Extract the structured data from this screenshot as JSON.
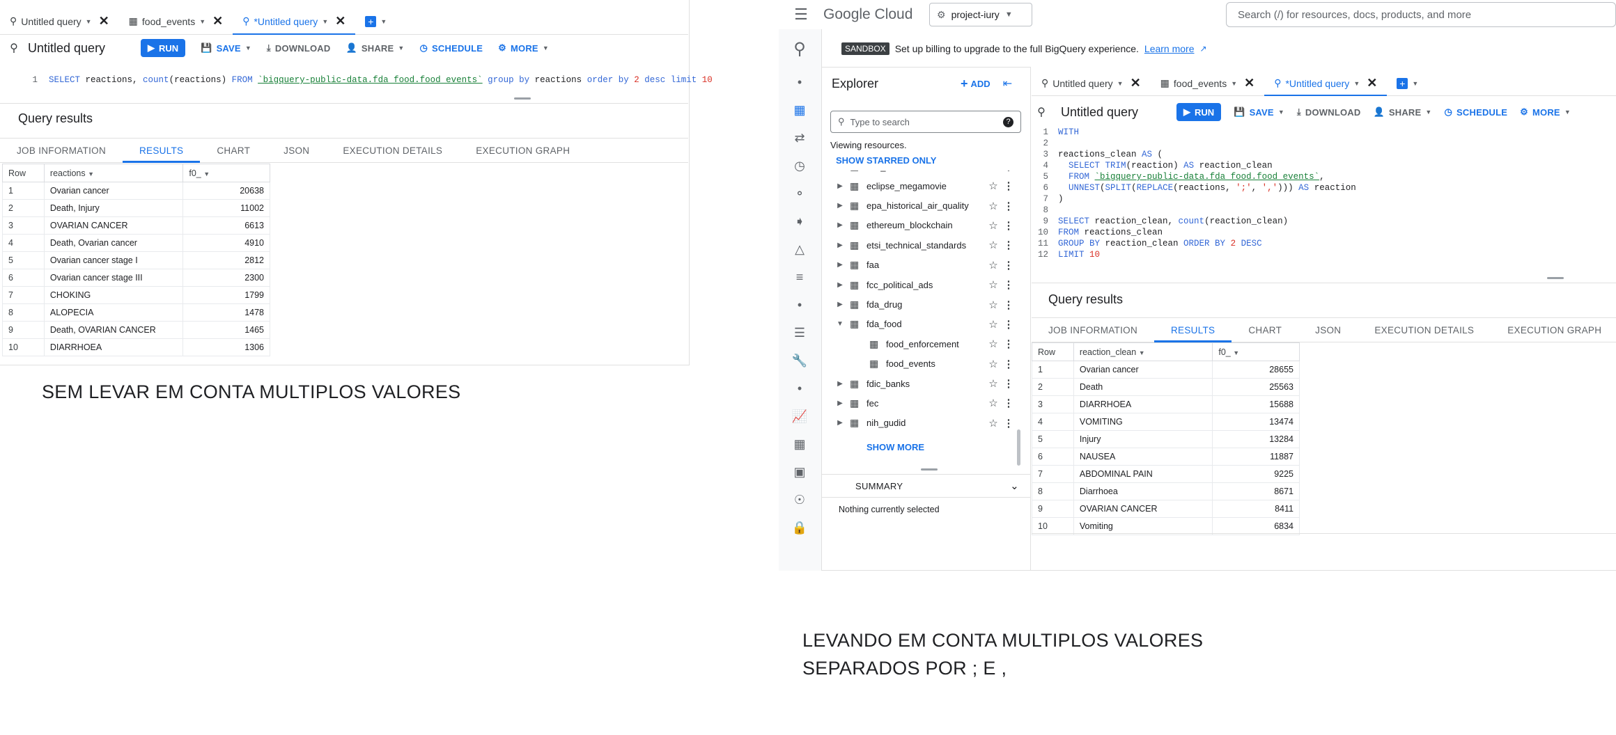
{
  "left": {
    "tabs": [
      {
        "label": "Untitled query",
        "icon": "query-icon",
        "active": false
      },
      {
        "label": "food_events",
        "icon": "table-icon",
        "active": false
      },
      {
        "label": "*Untitled query",
        "icon": "query-icon",
        "active": true
      }
    ],
    "title": "Untitled query",
    "toolbar": {
      "run": "RUN",
      "save": "SAVE",
      "download": "DOWNLOAD",
      "share": "SHARE",
      "schedule": "SCHEDULE",
      "more": "MORE"
    },
    "editor": {
      "line_no": "1",
      "select_kw": "SELECT",
      "select_cols": " reactions, ",
      "count_fn": "count",
      "count_arg": "(reactions) ",
      "from_kw": "FROM ",
      "table": "`bigquery-public-data.fda_food.food_events`",
      "group_kw": " group by",
      "group_col": " reactions",
      "order_kw": " order by ",
      "order_num": "2",
      "desc_kw": " desc limit ",
      "limit_num": "10"
    },
    "results_title": "Query results",
    "result_tabs": [
      "JOB INFORMATION",
      "RESULTS",
      "CHART",
      "JSON",
      "EXECUTION DETAILS",
      "EXECUTION GRAPH"
    ],
    "columns": [
      "Row",
      "reactions",
      "f0_"
    ],
    "rows": [
      [
        "1",
        "Ovarian cancer",
        "20638"
      ],
      [
        "2",
        "Death, Injury",
        "11002"
      ],
      [
        "3",
        "OVARIAN CANCER",
        "6613"
      ],
      [
        "4",
        "Death, Ovarian cancer",
        "4910"
      ],
      [
        "5",
        "Ovarian cancer stage I",
        "2812"
      ],
      [
        "6",
        "Ovarian cancer stage III",
        "2300"
      ],
      [
        "7",
        "CHOKING",
        "1799"
      ],
      [
        "8",
        "ALOPECIA",
        "1478"
      ],
      [
        "9",
        "Death, OVARIAN CANCER",
        "1465"
      ],
      [
        "10",
        "DIARRHOEA",
        "1306"
      ]
    ],
    "note": "SEM LEVAR EM CONTA MULTIPLOS VALORES"
  },
  "right": {
    "brand": "Google Cloud",
    "project": "project-iury",
    "search_placeholder": "Search (/) for resources, docs, products, and more",
    "sandbox_badge": "SANDBOX",
    "sandbox_text": "Set up billing to upgrade to the full BigQuery experience.",
    "learn_more": "Learn more",
    "explorer": {
      "title": "Explorer",
      "add": "ADD",
      "search_placeholder": "Type to search",
      "viewing": "Viewing resources.",
      "show_starred": "SHOW STARRED ONLY",
      "cutoff_item": "cdc_sarscenbsi",
      "items": [
        {
          "label": "eclipse_megamovie",
          "expanded": false,
          "child": false
        },
        {
          "label": "epa_historical_air_quality",
          "expanded": false,
          "child": false
        },
        {
          "label": "ethereum_blockchain",
          "expanded": false,
          "child": false
        },
        {
          "label": "etsi_technical_standards",
          "expanded": false,
          "child": false
        },
        {
          "label": "faa",
          "expanded": false,
          "child": false
        },
        {
          "label": "fcc_political_ads",
          "expanded": false,
          "child": false
        },
        {
          "label": "fda_drug",
          "expanded": false,
          "child": false
        },
        {
          "label": "fda_food",
          "expanded": true,
          "child": false
        },
        {
          "label": "food_enforcement",
          "expanded": false,
          "child": true
        },
        {
          "label": "food_events",
          "expanded": false,
          "child": true
        },
        {
          "label": "fdic_banks",
          "expanded": false,
          "child": false
        },
        {
          "label": "fec",
          "expanded": false,
          "child": false
        },
        {
          "label": "nih_gudid",
          "expanded": false,
          "child": false
        }
      ],
      "show_more": "SHOW MORE",
      "summary": "SUMMARY",
      "summary_text": "Nothing currently selected"
    },
    "tabs": [
      {
        "label": "Untitled query",
        "active": false
      },
      {
        "label": "food_events",
        "active": false
      },
      {
        "label": "*Untitled query",
        "active": true
      }
    ],
    "title": "Untitled query",
    "toolbar": {
      "run": "RUN",
      "save": "SAVE",
      "download": "DOWNLOAD",
      "share": "SHARE",
      "schedule": "SCHEDULE",
      "more": "MORE"
    },
    "code_lines": [
      {
        "n": "1",
        "parts": [
          [
            "kw",
            "WITH"
          ]
        ]
      },
      {
        "n": "2",
        "parts": []
      },
      {
        "n": "3",
        "parts": [
          [
            "",
            "reactions_clean "
          ],
          [
            "kw",
            "AS"
          ],
          [
            "",
            " ("
          ]
        ]
      },
      {
        "n": "4",
        "parts": [
          [
            "",
            "  "
          ],
          [
            "kw",
            "SELECT"
          ],
          [
            "",
            " "
          ],
          [
            "kw",
            "TRIM"
          ],
          [
            "",
            "(reaction) "
          ],
          [
            "kw",
            "AS"
          ],
          [
            "",
            " reaction_clean"
          ]
        ]
      },
      {
        "n": "5",
        "parts": [
          [
            "",
            "  "
          ],
          [
            "kw",
            "FROM"
          ],
          [
            "",
            " "
          ],
          [
            "str",
            "`bigquery-public-data.fda_food.food_events`"
          ],
          [
            "",
            ","
          ]
        ]
      },
      {
        "n": "6",
        "parts": [
          [
            "",
            "  "
          ],
          [
            "kw",
            "UNNEST"
          ],
          [
            "",
            "("
          ],
          [
            "kw",
            "SPLIT"
          ],
          [
            "",
            "("
          ],
          [
            "kw",
            "REPLACE"
          ],
          [
            "",
            "(reactions, "
          ],
          [
            "num",
            "';'"
          ],
          [
            "",
            ", "
          ],
          [
            "num",
            "','"
          ],
          [
            "",
            "))) "
          ],
          [
            "kw",
            "AS"
          ],
          [
            "",
            " reaction"
          ]
        ]
      },
      {
        "n": "7",
        "parts": [
          [
            "",
            ")"
          ]
        ]
      },
      {
        "n": "8",
        "parts": []
      },
      {
        "n": "9",
        "parts": [
          [
            "kw",
            "SELECT"
          ],
          [
            "",
            " reaction_clean, "
          ],
          [
            "kw",
            "count"
          ],
          [
            "",
            "(reaction_clean)"
          ]
        ]
      },
      {
        "n": "10",
        "parts": [
          [
            "kw",
            "FROM"
          ],
          [
            "",
            " reactions_clean"
          ]
        ]
      },
      {
        "n": "11",
        "parts": [
          [
            "kw",
            "GROUP BY"
          ],
          [
            "",
            " reaction_clean "
          ],
          [
            "kw",
            "ORDER BY"
          ],
          [
            "",
            " "
          ],
          [
            "num",
            "2"
          ],
          [
            "",
            " "
          ],
          [
            "kw",
            "DESC"
          ]
        ]
      },
      {
        "n": "12",
        "parts": [
          [
            "kw",
            "LIMIT"
          ],
          [
            "",
            " "
          ],
          [
            "num",
            "10"
          ]
        ]
      }
    ],
    "results_title": "Query results",
    "result_tabs": [
      "JOB INFORMATION",
      "RESULTS",
      "CHART",
      "JSON",
      "EXECUTION DETAILS",
      "EXECUTION GRAPH"
    ],
    "columns": [
      "Row",
      "reaction_clean",
      "f0_"
    ],
    "rows": [
      [
        "1",
        "Ovarian cancer",
        "28655"
      ],
      [
        "2",
        "Death",
        "25563"
      ],
      [
        "3",
        "DIARRHOEA",
        "15688"
      ],
      [
        "4",
        "VOMITING",
        "13474"
      ],
      [
        "5",
        "Injury",
        "13284"
      ],
      [
        "6",
        "NAUSEA",
        "11887"
      ],
      [
        "7",
        "ABDOMINAL PAIN",
        "9225"
      ],
      [
        "8",
        "Diarrhoea",
        "8671"
      ],
      [
        "9",
        "OVARIAN CANCER",
        "8411"
      ],
      [
        "10",
        "Vomiting",
        "6834"
      ]
    ],
    "note_line1": "LEVANDO EM CONTA MULTIPLOS VALORES",
    "note_line2": "SEPARADOS POR ; E ,"
  }
}
